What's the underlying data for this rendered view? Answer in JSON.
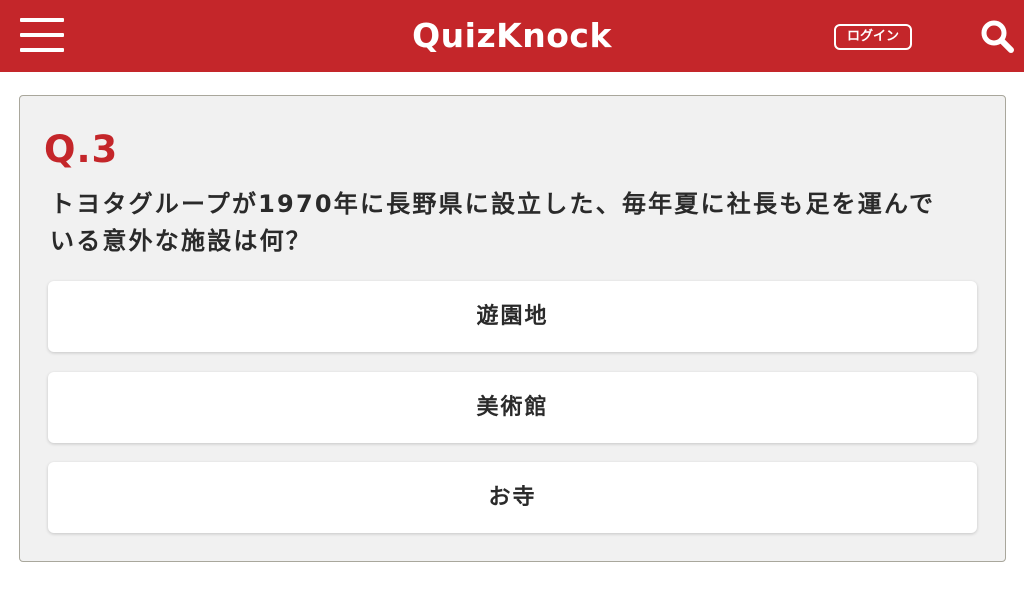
{
  "header": {
    "logo": "QuizKnock",
    "login_label": "ログイン",
    "menu_icon": "hamburger-menu-icon",
    "search_icon": "search-icon",
    "background_color": "#c4262a"
  },
  "quiz": {
    "number": "Q.3",
    "question_line1": "トヨタグループが1970年に長野県に設立した、毎年夏に社長も足を運んで",
    "question_line2": "いる意外な施設は何？",
    "choices": [
      {
        "label": "遊園地"
      },
      {
        "label": "美術館"
      },
      {
        "label": "お寺"
      }
    ],
    "accent_color": "#c4262a"
  }
}
